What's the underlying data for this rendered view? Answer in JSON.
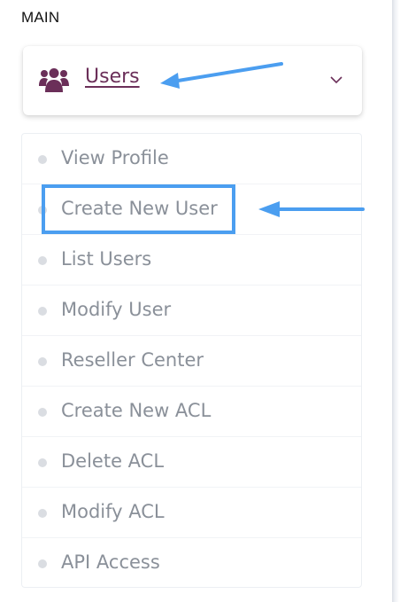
{
  "sidebar": {
    "section_title": "MAIN",
    "menu": {
      "label": "Users",
      "icon": "users-icon",
      "expand_icon": "chevron-down-icon",
      "accent_color": "#6b2f59"
    },
    "items": [
      {
        "label": "View Profile"
      },
      {
        "label": "Create New User"
      },
      {
        "label": "List Users"
      },
      {
        "label": "Modify User"
      },
      {
        "label": "Reseller Center"
      },
      {
        "label": "Create New ACL"
      },
      {
        "label": "Delete ACL"
      },
      {
        "label": "Modify ACL"
      },
      {
        "label": "API Access"
      }
    ]
  },
  "annotations": {
    "color": "#4b9ef0",
    "highlighted_item": "Create New User"
  }
}
